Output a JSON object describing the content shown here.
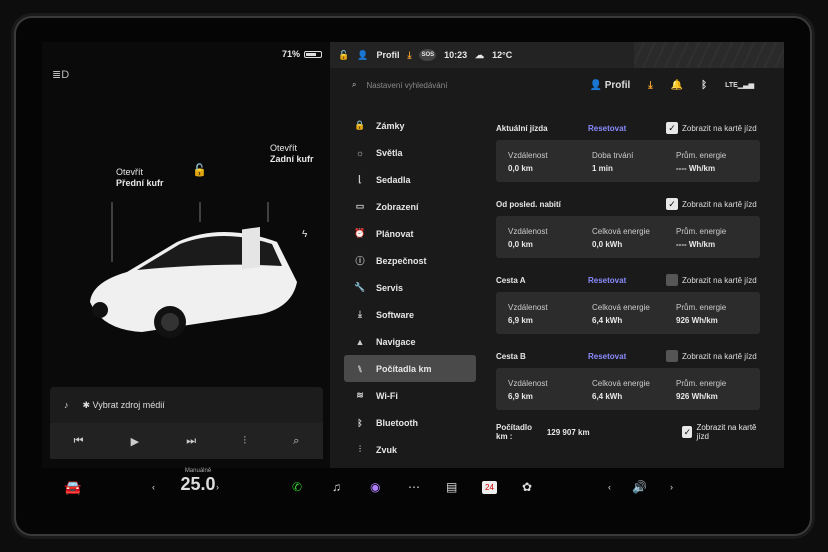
{
  "status": {
    "battery": "71%",
    "profile": "Profil",
    "sos": "SOS",
    "time": "10:23",
    "temp": "12°C"
  },
  "car": {
    "front_trunk_action": "Otevřít",
    "front_trunk_name": "Přední kufr",
    "rear_trunk_action": "Otevřít",
    "rear_trunk_name": "Zadní kufr"
  },
  "media": {
    "source_label": "Vybrat zdroj médií"
  },
  "search": {
    "placeholder": "Nastavení vyhledávání",
    "profile": "Profil"
  },
  "menu": [
    {
      "label": "Zámky",
      "icon": "lock-icon",
      "glyph": "🔒"
    },
    {
      "label": "Světla",
      "icon": "sun-icon",
      "glyph": "☼"
    },
    {
      "label": "Sedadla",
      "icon": "seat-icon",
      "glyph": "⌊"
    },
    {
      "label": "Zobrazení",
      "icon": "display-icon",
      "glyph": "▭"
    },
    {
      "label": "Plánovat",
      "icon": "alarm-icon",
      "glyph": "⏰"
    },
    {
      "label": "Bezpečnost",
      "icon": "info-icon",
      "glyph": "ⓘ"
    },
    {
      "label": "Servis",
      "icon": "wrench-icon",
      "glyph": "🔧"
    },
    {
      "label": "Software",
      "icon": "download-icon",
      "glyph": "⤓"
    },
    {
      "label": "Navigace",
      "icon": "navigation-icon",
      "glyph": "▲"
    },
    {
      "label": "Počítadla km",
      "icon": "odometer-icon",
      "glyph": "⑊"
    },
    {
      "label": "Wi-Fi",
      "icon": "wifi-icon",
      "glyph": "≋"
    },
    {
      "label": "Bluetooth",
      "icon": "bluetooth-icon",
      "glyph": "ᛒ"
    },
    {
      "label": "Zvuk",
      "icon": "equalizer-icon",
      "glyph": "⫶"
    }
  ],
  "menu_active": 9,
  "trips": [
    {
      "title": "Aktuální jízda",
      "reset": "Resetovat",
      "checkbox": "Zobrazit na kartě jízd",
      "checked": true,
      "cols": [
        {
          "k": "Vzdálenost",
          "v": "0,0 km"
        },
        {
          "k": "Doba trvání",
          "v": "1 min"
        },
        {
          "k": "Prům. energie",
          "v": "---- Wh/km"
        }
      ]
    },
    {
      "title": "Od posled. nabití",
      "reset": "",
      "checkbox": "Zobrazit na kartě jízd",
      "checked": true,
      "cols": [
        {
          "k": "Vzdálenost",
          "v": "0,0 km"
        },
        {
          "k": "Celková energie",
          "v": "0,0 kWh"
        },
        {
          "k": "Prům. energie",
          "v": "---- Wh/km"
        }
      ]
    },
    {
      "title": "Cesta A",
      "reset": "Resetovat",
      "checkbox": "Zobrazit na kartě jízd",
      "checked": false,
      "cols": [
        {
          "k": "Vzdálenost",
          "v": "6,9 km"
        },
        {
          "k": "Celková energie",
          "v": "6,4 kWh"
        },
        {
          "k": "Prům. energie",
          "v": "926 Wh/km"
        }
      ]
    },
    {
      "title": "Cesta B",
      "reset": "Resetovat",
      "checkbox": "Zobrazit na kartě jízd",
      "checked": false,
      "cols": [
        {
          "k": "Vzdálenost",
          "v": "6,9 km"
        },
        {
          "k": "Celková energie",
          "v": "6,4 kWh"
        },
        {
          "k": "Prům. energie",
          "v": "926 Wh/km"
        }
      ]
    }
  ],
  "odometer": {
    "label": "Počítadlo km :",
    "value": "129 907 km",
    "checkbox": "Zobrazit na kartě jízd",
    "checked": true
  },
  "dock": {
    "climate_mode": "Manuálně",
    "temperature": "25.0",
    "calendar_day": "24"
  },
  "colors": {
    "accent": "#8a8aff",
    "panel": "#1a1a1a",
    "card": "#2c2c2c",
    "active": "#4a4a4a"
  }
}
